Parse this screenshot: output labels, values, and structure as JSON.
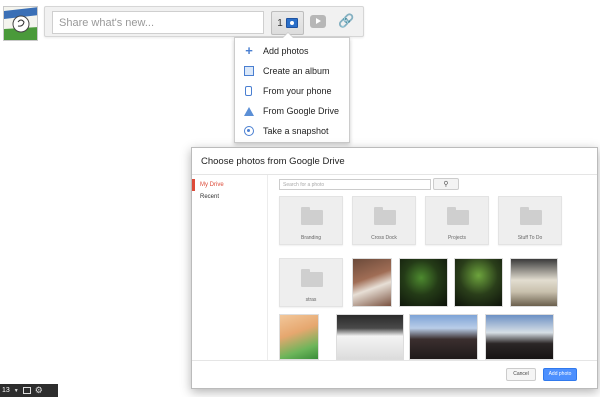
{
  "share": {
    "placeholder": "Share what's new...",
    "photo_count": "1"
  },
  "menu": {
    "items": [
      {
        "label": "Add photos",
        "icon": "plus-icon"
      },
      {
        "label": "Create an album",
        "icon": "album-icon"
      },
      {
        "label": "From your phone",
        "icon": "phone-icon"
      },
      {
        "label": "From Google Drive",
        "icon": "drive-icon"
      },
      {
        "label": "Take a snapshot",
        "icon": "snapshot-icon"
      }
    ]
  },
  "dialog": {
    "title": "Choose photos from Google Drive",
    "nav": {
      "my_drive": "My Drive",
      "recent": "Recent"
    },
    "search_placeholder": "Search for a photo",
    "folders": [
      "Branding",
      "Cross Dock",
      "Projects",
      "Stuff To Do",
      "stras"
    ],
    "cancel_label": "Cancel",
    "add_label": "Add photo"
  },
  "bottom_bar": {
    "count": "13"
  },
  "colors": {
    "accent_red": "#dd4b39",
    "primary_blue": "#4d90fe"
  }
}
